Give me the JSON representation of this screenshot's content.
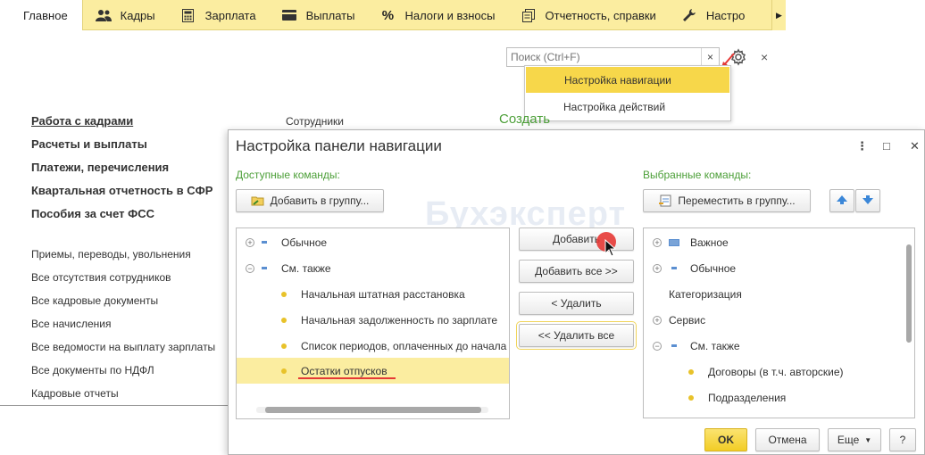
{
  "sections": [
    {
      "label": "Главное",
      "icon": "home-icon"
    },
    {
      "label": "Кадры",
      "icon": "people-icon"
    },
    {
      "label": "Зарплата",
      "icon": "calculator-icon"
    },
    {
      "label": "Выплаты",
      "icon": "wallet-icon"
    },
    {
      "label": "Налоги и взносы",
      "icon": "percent-icon"
    },
    {
      "label": "Отчетность, справки",
      "icon": "documents-icon"
    },
    {
      "label": "Настро",
      "icon": "wrench-icon"
    }
  ],
  "search": {
    "placeholder": "Поиск (Ctrl+F)",
    "clear": "×"
  },
  "page_close": "×",
  "dropdown": {
    "items": [
      "Настройка навигации",
      "Настройка действий"
    ]
  },
  "nav": {
    "main": [
      "Работа с кадрами",
      "Расчеты и выплаты",
      "Платежи, перечисления",
      "Квартальная отчетность в СФР",
      "Пособия за счет ФСС"
    ],
    "links": [
      "Приемы, переводы, увольнения",
      "Все отсутствия сотрудников",
      "Все кадровые документы",
      "Все начисления",
      "Все ведомости на выплату зарплаты",
      "Все документы по НДФЛ",
      "Кадровые отчеты"
    ]
  },
  "content": {
    "employees": "Сотрудники",
    "create": "Создать"
  },
  "dialog": {
    "title": "Настройка панели навигации",
    "controls": {
      "more": "⋮",
      "maximize": "□",
      "close": "✕"
    },
    "available_label": "Доступные команды:",
    "selected_label": "Выбранные команды:",
    "add_to_group": "Добавить в группу...",
    "move_to_group": "Переместить в группу...",
    "available": [
      {
        "text": "Обычное",
        "kind": "group-collapsed"
      },
      {
        "text": "См. также",
        "kind": "group-expanded"
      },
      {
        "text": "Начальная штатная расстановка",
        "kind": "item"
      },
      {
        "text": "Начальная задолженность по зарплате",
        "kind": "item"
      },
      {
        "text": "Список периодов, оплаченных до начала",
        "kind": "item"
      },
      {
        "text": "Остатки отпусков",
        "kind": "item",
        "selected": true
      }
    ],
    "selected": [
      {
        "text": "Важное",
        "kind": "group-collapsed-important"
      },
      {
        "text": "Обычное",
        "kind": "group-collapsed"
      },
      {
        "text": "Категоризация",
        "kind": "plain"
      },
      {
        "text": "Сервис",
        "kind": "group-collapsed-plain"
      },
      {
        "text": "См. также",
        "kind": "group-expanded"
      },
      {
        "text": "Договоры (в т.ч. авторские)",
        "kind": "item"
      },
      {
        "text": "Подразделения",
        "kind": "item"
      }
    ],
    "buttons": {
      "add": "Добавить",
      "add_all": "Добавить все >>",
      "remove": "< Удалить",
      "remove_all": "<< Удалить все"
    },
    "footer": {
      "ok": "OK",
      "cancel": "Отмена",
      "more": "Еще",
      "help": "?"
    },
    "watermark": "Бухэксперт"
  },
  "colors": {
    "section_bar": "#fbeda0",
    "highlight": "#f7d74a",
    "ok_button": "#f6d52f",
    "green_label": "#4c9f38",
    "annotation_red": "#e53935"
  }
}
